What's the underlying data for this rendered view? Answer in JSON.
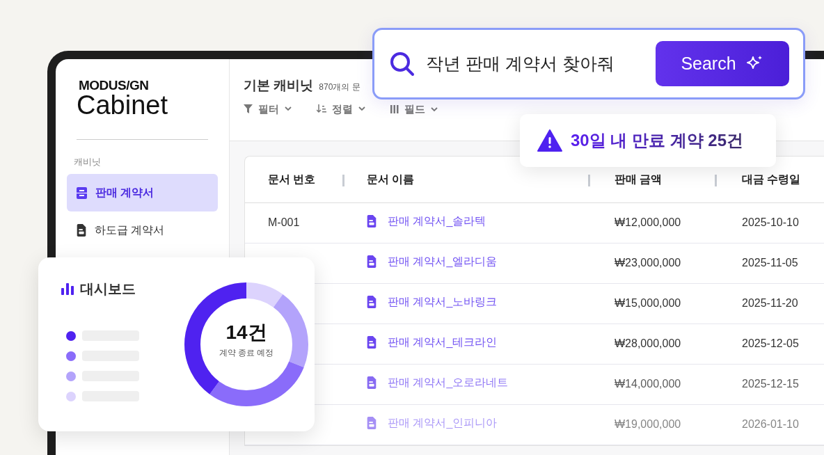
{
  "search": {
    "value": "작년 판매 계약서 찾아줘",
    "button": "Search"
  },
  "alert": {
    "text": "30일 내 만료 계약 25건"
  },
  "sidebar": {
    "logo_top": "MODUS/GN",
    "logo_bottom": "Cabinet",
    "section": "캐비닛",
    "items": [
      {
        "kind": "drawer",
        "label": "판매 계약서",
        "selected": true
      },
      {
        "kind": "document",
        "label": "하도급 계약서",
        "selected": false
      }
    ]
  },
  "header": {
    "title": "기본 캐비닛",
    "count": "870개의 문"
  },
  "toolbar": [
    {
      "kind": "filter",
      "label": "필터"
    },
    {
      "kind": "sort",
      "label": "정렬"
    },
    {
      "kind": "fields",
      "label": "필드"
    }
  ],
  "table": {
    "columns": [
      "문서 번호",
      "문서 이름",
      "판매 금액",
      "대금 수령일"
    ],
    "rows": [
      {
        "number": "M-001",
        "name": "판매 계약서_솔라텍",
        "amount": "₩12,000,000",
        "date": "2025-10-10"
      },
      {
        "name": "판매 계약서_엘라디움",
        "amount": "₩23,000,000",
        "date": "2025-11-05"
      },
      {
        "name": "판매 계약서_노바링크",
        "amount": "₩15,000,000",
        "date": "2025-11-20"
      },
      {
        "name": "판매 계약서_테크라인",
        "amount": "₩28,000,000",
        "date": "2025-12-05"
      },
      {
        "name": "판매 계약서_오로라네트",
        "amount": "₩14,000,000",
        "date": "2025-12-15"
      },
      {
        "name": "판매 계약서_인피니아",
        "amount": "₩19,000,000",
        "date": "2026-01-10"
      }
    ]
  },
  "dashboard": {
    "title": "대시보드",
    "legend": [
      {
        "color": "#4f22f0"
      },
      {
        "color": "#8a6cfa"
      },
      {
        "color": "#b3a3fb"
      },
      {
        "color": "#dcd3fd"
      }
    ],
    "total": "14건",
    "caption": "계약 종료 예정"
  }
}
